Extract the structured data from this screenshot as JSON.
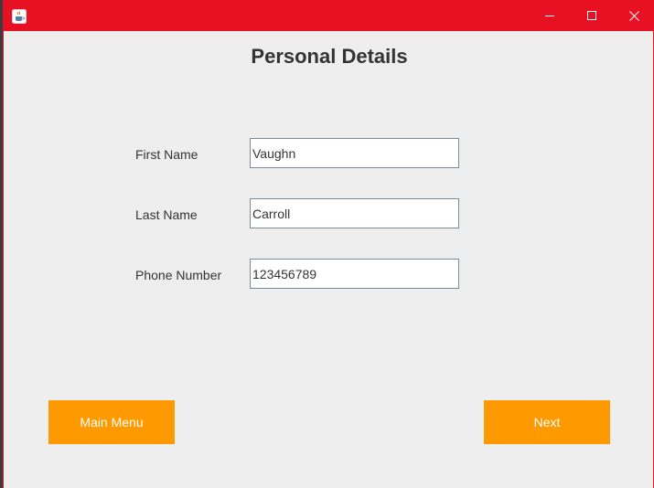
{
  "window": {
    "title": "",
    "accent_color": "#e81123",
    "icons": [
      "java-coffee-cup-icon",
      "minimize-icon",
      "maximize-icon",
      "close-icon"
    ]
  },
  "page": {
    "title": "Personal Details"
  },
  "form": {
    "first_name": {
      "label": "First Name",
      "value": "Vaughn"
    },
    "last_name": {
      "label": "Last Name",
      "value": "Carroll"
    },
    "phone_number": {
      "label": "Phone Number",
      "value": "123456789"
    }
  },
  "buttons": {
    "main_menu": "Main Menu",
    "next": "Next",
    "color": "#ff9900"
  }
}
